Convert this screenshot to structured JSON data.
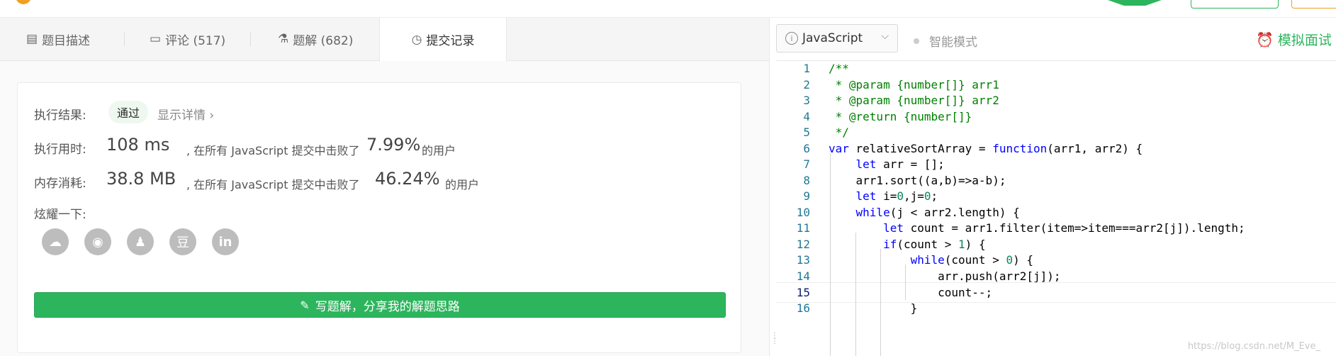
{
  "tabs": {
    "description": "题目描述",
    "comments": "评论 (517)",
    "solutions": "题解 (682)",
    "submissions": "提交记录"
  },
  "result": {
    "status_label": "执行结果:",
    "status_badge": "通过",
    "details_link": "显示详情 ›",
    "runtime_label": "执行用时:",
    "runtime_value": "108 ms",
    "runtime_prefix": ", 在所有 JavaScript 提交中击败了",
    "runtime_percent": "7.99%",
    "runtime_suffix": "的用户",
    "memory_label": "内存消耗:",
    "memory_value": "38.8 MB",
    "memory_prefix": ", 在所有 JavaScript 提交中击败了",
    "memory_percent": "46.24%",
    "memory_suffix": "的用户",
    "share_label": "炫耀一下:",
    "share_icons": [
      "wechat-icon",
      "weibo-icon",
      "qq-icon",
      "douban-icon",
      "linkedin-icon"
    ],
    "douban_glyph": "豆",
    "linkedin_glyph": "in",
    "write_button": "写题解，分享我的解题思路"
  },
  "editor": {
    "language": "JavaScript",
    "smart_mode": "智能模式",
    "mock_interview": "模拟面试",
    "current_line": 15,
    "lines": [
      [
        [
          "com",
          "/**"
        ]
      ],
      [
        [
          "com",
          " * @param {number[]} arr1"
        ]
      ],
      [
        [
          "com",
          " * @param {number[]} arr2"
        ]
      ],
      [
        [
          "com",
          " * @return {number[]}"
        ]
      ],
      [
        [
          "com",
          " */"
        ]
      ],
      [
        [
          "kw",
          "var"
        ],
        [
          "txt",
          " relativeSortArray = "
        ],
        [
          "kw",
          "function"
        ],
        [
          "txt",
          "(arr1, arr2) {"
        ]
      ],
      [
        [
          "txt",
          "    "
        ],
        [
          "kw",
          "let"
        ],
        [
          "txt",
          " arr = [];"
        ]
      ],
      [
        [
          "txt",
          "    arr1.sort((a,b)=>a-b);"
        ]
      ],
      [
        [
          "txt",
          "    "
        ],
        [
          "kw",
          "let"
        ],
        [
          "txt",
          " i="
        ],
        [
          "num",
          "0"
        ],
        [
          "txt",
          ",j="
        ],
        [
          "num",
          "0"
        ],
        [
          "txt",
          ";"
        ]
      ],
      [
        [
          "txt",
          "    "
        ],
        [
          "kw",
          "while"
        ],
        [
          "txt",
          "(j < arr2.length) {"
        ]
      ],
      [
        [
          "txt",
          "        "
        ],
        [
          "kw",
          "let"
        ],
        [
          "txt",
          " count = arr1.filter(item=>item===arr2[j]).length;"
        ]
      ],
      [
        [
          "txt",
          "        "
        ],
        [
          "kw",
          "if"
        ],
        [
          "txt",
          "(count > "
        ],
        [
          "num",
          "1"
        ],
        [
          "txt",
          ") {"
        ]
      ],
      [
        [
          "txt",
          "            "
        ],
        [
          "kw",
          "while"
        ],
        [
          "txt",
          "(count > "
        ],
        [
          "num",
          "0"
        ],
        [
          "txt",
          ") {"
        ]
      ],
      [
        [
          "txt",
          "                arr.push(arr2[j]);"
        ]
      ],
      [
        [
          "txt",
          "                count--;"
        ]
      ],
      [
        [
          "txt",
          "            }"
        ]
      ]
    ]
  },
  "watermark": "https://blog.csdn.net/M_Eve_"
}
